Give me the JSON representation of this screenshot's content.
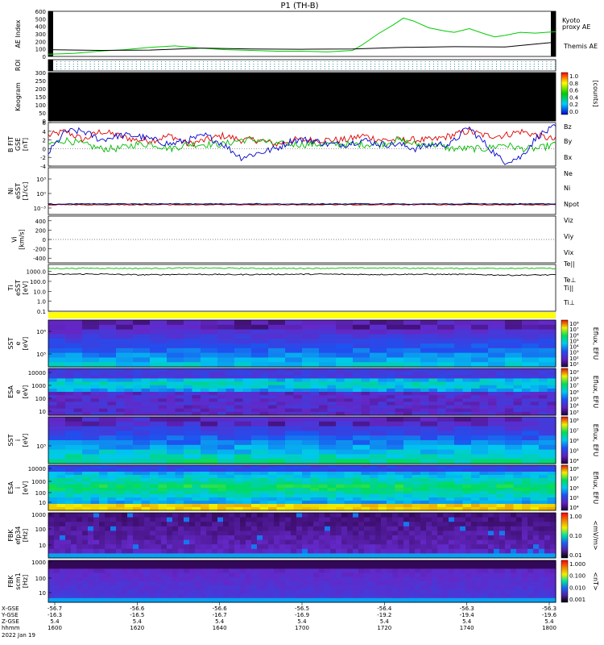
{
  "title": "P1 (TH-B)",
  "colors": {
    "kyoto": "#00cc00",
    "themis": "#000000",
    "bz": "#dd0000",
    "by": "#00bb00",
    "bx": "#0000cc",
    "ne": "#cc0000",
    "npot": "#000080",
    "te": "#cc0000",
    "ti": "#00bb00",
    "tiperp": "#0000aa"
  },
  "chart_data": [
    {
      "id": "ae",
      "type": "line",
      "ylabel": "AE Index",
      "ylim": [
        0,
        600
      ],
      "yticks": [
        "600",
        "500",
        "400",
        "300",
        "200",
        "100",
        "0"
      ],
      "series": [
        {
          "name": "Kyoto proxy AE",
          "name_lines": [
            "Kyoto",
            "proxy AE"
          ],
          "x": [
            0,
            0.05,
            0.1,
            0.15,
            0.2,
            0.25,
            0.3,
            0.35,
            0.4,
            0.45,
            0.5,
            0.55,
            0.6,
            0.62,
            0.65,
            0.68,
            0.7,
            0.72,
            0.75,
            0.78,
            0.8,
            0.83,
            0.86,
            0.88,
            0.9,
            0.93,
            0.96,
            1.0
          ],
          "values": [
            30,
            40,
            70,
            90,
            120,
            140,
            110,
            90,
            80,
            70,
            70,
            60,
            80,
            160,
            300,
            420,
            510,
            470,
            380,
            340,
            320,
            370,
            300,
            260,
            280,
            320,
            310,
            330
          ]
        },
        {
          "name": "Themis AE",
          "x": [
            0,
            0.1,
            0.2,
            0.3,
            0.4,
            0.5,
            0.6,
            0.7,
            0.8,
            0.9,
            1.0
          ],
          "values": [
            90,
            80,
            85,
            110,
            100,
            95,
            100,
            120,
            130,
            125,
            190
          ]
        }
      ]
    },
    {
      "id": "roi",
      "type": "heatmap",
      "ylabel": "ROI"
    },
    {
      "id": "keogram",
      "type": "heatmap",
      "ylabel": "Keogram",
      "yticks": [
        "300",
        "250",
        "200",
        "150",
        "100",
        "50",
        "0"
      ],
      "colorbar_label": "[counts]",
      "colorbar_ticks": [
        "1.0",
        "0.8",
        "0.6",
        "0.4",
        "0.2",
        "0.0"
      ]
    },
    {
      "id": "bfield",
      "type": "line",
      "ylabel_lines": [
        "B FIT",
        "GSE",
        "[nT]"
      ],
      "ylim": [
        -4,
        6
      ],
      "yticks": [
        "6",
        "4",
        "2",
        "0",
        "-2",
        "-4"
      ],
      "series": [
        {
          "name": "Bz",
          "values": [
            3,
            4,
            2,
            4,
            3,
            2,
            2,
            3,
            1,
            2,
            3,
            2,
            2,
            1,
            2,
            2,
            2,
            2,
            3,
            2,
            2,
            2,
            2,
            3,
            4,
            3,
            3,
            4,
            3,
            2
          ]
        },
        {
          "name": "By",
          "values": [
            1,
            2,
            1,
            0,
            0,
            1,
            1,
            0,
            1,
            1,
            1,
            2,
            2,
            1,
            1,
            1,
            1,
            1,
            1,
            1,
            2,
            1,
            1,
            0,
            0,
            0,
            1,
            0,
            0,
            1
          ]
        },
        {
          "name": "Bx",
          "values": [
            -1,
            4,
            4,
            2,
            3,
            3,
            2,
            1,
            2,
            3,
            1,
            -2,
            -1,
            0,
            2,
            2,
            1,
            1,
            2,
            1,
            1,
            0,
            1,
            1,
            5,
            1,
            -3,
            -2,
            3,
            5
          ]
        }
      ]
    },
    {
      "id": "density",
      "type": "line",
      "ylabel_lines": [
        "Ni",
        "eSST",
        "[1/cc]"
      ],
      "yticks": [
        "10³",
        "10⁰",
        "10⁻³"
      ],
      "series": [
        {
          "name": "Ne",
          "values": [
            0.1,
            0.1,
            0.1,
            0.1,
            0.1,
            0.1
          ]
        },
        {
          "name": "Ni",
          "values": [
            0.1,
            0.1,
            0.1,
            0.1,
            0.1,
            0.1
          ]
        },
        {
          "name": "Npot",
          "values": [
            0.1,
            0.1,
            0.1,
            0.1,
            0.1,
            0.1
          ]
        }
      ]
    },
    {
      "id": "velocity",
      "type": "line",
      "ylabel_lines": [
        "Vi",
        "[km/s]"
      ],
      "ylim": [
        -500,
        500
      ],
      "yticks": [
        "400",
        "200",
        "0",
        "-200",
        "-400"
      ],
      "series": [
        {
          "name": "Viz"
        },
        {
          "name": "Viy"
        },
        {
          "name": "Vix"
        }
      ]
    },
    {
      "id": "temperature",
      "type": "line",
      "ylabel_lines": [
        "Ti",
        "eSST",
        "[eV]"
      ],
      "yticks": [
        "1000.0",
        "100.0",
        "10.0",
        "1.0",
        "0.1"
      ],
      "series": [
        {
          "name": "Te||",
          "values": [
            2000,
            2100,
            2000,
            2200,
            2100,
            2000,
            2100,
            2200,
            2100,
            2000,
            2100,
            2000
          ]
        },
        {
          "name": "Te⊥"
        },
        {
          "name": "Ti||",
          "values": [
            500,
            550,
            450,
            520,
            480,
            510,
            530,
            490,
            520,
            500,
            420,
            450
          ]
        },
        {
          "name": "Ti⊥"
        }
      ]
    },
    {
      "id": "sst_e",
      "type": "heatmap",
      "ylabel_lines": [
        "SST",
        "e",
        "[eV]"
      ],
      "yticks": [
        "10⁶",
        "10⁵"
      ],
      "colorbar_label": "Eflux, EFU",
      "colorbar_ticks": [
        "10⁸",
        "10⁷",
        "10⁶",
        "10⁵",
        "10⁴",
        "10³",
        "10²",
        "10¹"
      ]
    },
    {
      "id": "esa_e",
      "type": "heatmap",
      "ylabel_lines": [
        "ESA",
        "e",
        "[eV]"
      ],
      "yticks": [
        "10000",
        "1000",
        "100",
        "10"
      ],
      "colorbar_label": "Eflux, EFU",
      "colorbar_ticks": [
        "10⁹",
        "10⁸",
        "10⁷",
        "10⁶",
        "10⁵",
        "10⁴",
        "10³"
      ]
    },
    {
      "id": "sst_i",
      "type": "heatmap",
      "ylabel_lines": [
        "SST",
        "i",
        "[eV]"
      ],
      "yticks": [
        "10⁵"
      ],
      "colorbar_label": "Eflux, EFU",
      "colorbar_ticks": [
        "10⁸",
        "10⁷",
        "10⁶",
        "10⁵",
        "10⁴"
      ]
    },
    {
      "id": "esa_i",
      "type": "heatmap",
      "ylabel_lines": [
        "ESA",
        "i",
        "[eV]"
      ],
      "yticks": [
        "10000",
        "1000",
        "100",
        "10"
      ],
      "colorbar_label": "Eflux, EFU",
      "colorbar_ticks": [
        "10⁸",
        "10⁷",
        "10⁶",
        "10⁵",
        "10⁴"
      ]
    },
    {
      "id": "fbk_e",
      "type": "heatmap",
      "ylabel_lines": [
        "FBK",
        "efp34",
        "[Hz]"
      ],
      "yticks": [
        "1000",
        "100",
        "10"
      ],
      "colorbar_label": "<mV/m>",
      "colorbar_ticks": [
        "1.00",
        "0.10",
        "0.01"
      ]
    },
    {
      "id": "fbk_b",
      "type": "heatmap",
      "ylabel_lines": [
        "FBK",
        "scm1",
        "[Hz]"
      ],
      "yticks": [
        "1000",
        "100",
        "10"
      ],
      "colorbar_label": "<nT>",
      "colorbar_ticks": [
        "1.000",
        "0.100",
        "0.010",
        "0.001"
      ]
    }
  ],
  "xaxis": {
    "row_labels": [
      "X-GSE",
      "Y-GSE",
      "Z-GSE",
      "hhmm"
    ],
    "date": "2022 Jan 19",
    "ticks": [
      {
        "x": "-56.7",
        "y": "-16.3",
        "z": "5.4",
        "t": "1600"
      },
      {
        "x": "-56.6",
        "y": "-16.5",
        "z": "5.4",
        "t": "1620"
      },
      {
        "x": "-56.6",
        "y": "-16.7",
        "z": "5.4",
        "t": "1640"
      },
      {
        "x": "-56.5",
        "y": "-16.9",
        "z": "5.4",
        "t": "1700"
      },
      {
        "x": "-56.4",
        "y": "-19.2",
        "z": "5.4",
        "t": "1720"
      },
      {
        "x": "-56.3",
        "y": "-19.4",
        "z": "5.4",
        "t": "1740"
      },
      {
        "x": "-56.3",
        "y": "-19.6",
        "z": "5.4",
        "t": "1800"
      }
    ]
  }
}
